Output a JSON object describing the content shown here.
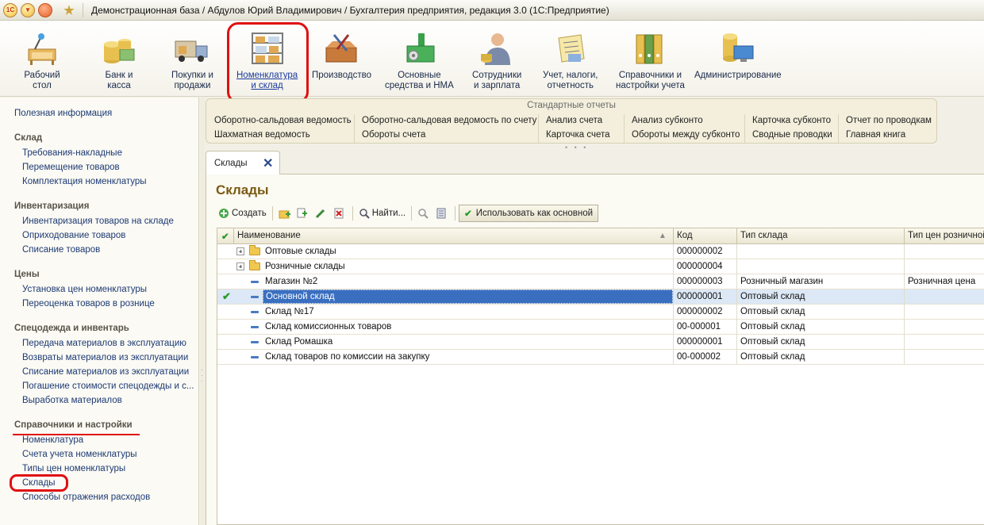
{
  "titlebar": {
    "logo": "1С",
    "title": "Демонстрационная база / Абдулов Юрий Владимирович / Бухгалтерия предприятия, редакция 3.0  (1С:Предприятие)"
  },
  "ribbon": [
    {
      "line1": "Рабочий",
      "line2": "стол",
      "icon": "desk-icon"
    },
    {
      "line1": "Банк и",
      "line2": "касса",
      "icon": "money-icon"
    },
    {
      "line1": "Покупки и",
      "line2": "продажи",
      "icon": "truck-icon"
    },
    {
      "line1": "Номенклатура",
      "line2": "и склад",
      "icon": "warehouse-shelves-icon",
      "active": true
    },
    {
      "line1": "Производство",
      "line2": "",
      "icon": "tools-box-icon"
    },
    {
      "line1": "Основные",
      "line2": "средства и НМА",
      "icon": "factory-icon"
    },
    {
      "line1": "Сотрудники",
      "line2": "и зарплата",
      "icon": "employee-icon"
    },
    {
      "line1": "Учет, налоги,",
      "line2": "отчетность",
      "icon": "reports-icon"
    },
    {
      "line1": "Справочники и",
      "line2": "настройки учета",
      "icon": "binders-icon"
    },
    {
      "line1": "Администрирование",
      "line2": "",
      "icon": "database-icon"
    }
  ],
  "left_panel": {
    "info": "Полезная информация",
    "groups": [
      {
        "title": "Склад",
        "items": [
          "Требования-накладные",
          "Перемещение товаров",
          "Комплектация номенклатуры"
        ]
      },
      {
        "title": "Инвентаризация",
        "items": [
          "Инвентаризация товаров на складе",
          "Оприходование товаров",
          "Списание товаров"
        ]
      },
      {
        "title": "Цены",
        "items": [
          "Установка цен номенклатуры",
          "Переоценка товаров в рознице"
        ]
      },
      {
        "title": "Спецодежда и инвентарь",
        "items": [
          "Передача материалов в эксплуатацию",
          "Возвраты материалов из эксплуатации",
          "Списание материалов из эксплуатации",
          "Погашение стоимости спецодежды и с...",
          "Выработка материалов"
        ]
      },
      {
        "title": "Справочники и настройки",
        "items": [
          "Номенклатура",
          "Счета учета номенклатуры",
          "Типы цен номенклатуры",
          "Склады",
          "Способы отражения расходов"
        ]
      }
    ]
  },
  "reports": {
    "title": "Стандартные отчеты",
    "col1": [
      "Оборотно-сальдовая ведомость",
      "Шахматная ведомость"
    ],
    "col2": [
      "Оборотно-сальдовая ведомость по счету",
      "Обороты счета"
    ],
    "col3": [
      "Анализ счета",
      "Карточка счета"
    ],
    "col4": [
      "Анализ субконто",
      "Обороты между субконто"
    ],
    "col5": [
      "Карточка субконто",
      "Сводные проводки"
    ],
    "col6": [
      "Отчет по проводкам",
      "Главная книга"
    ]
  },
  "tab": {
    "label": "Склады",
    "close": "✕"
  },
  "page": {
    "title": "Склады"
  },
  "toolbar": {
    "create": "Создать",
    "find": "Найти...",
    "use_as_main": "Использовать как основной"
  },
  "table": {
    "headers": {
      "name": "Наименование",
      "code": "Код",
      "type": "Тип склада",
      "price_type": "Тип цен розничной"
    },
    "rows": [
      {
        "kind": "group",
        "name": "Оптовые склады",
        "code": "000000002",
        "type": "",
        "price": ""
      },
      {
        "kind": "group",
        "name": "Розничные склады",
        "code": "000000004",
        "type": "",
        "price": ""
      },
      {
        "kind": "item",
        "name": "Магазин №2",
        "code": "000000003",
        "type": "Розничный магазин",
        "price": "Розничная цена"
      },
      {
        "kind": "item",
        "name": "Основной склад",
        "code": "000000001",
        "type": "Оптовый склад",
        "price": "",
        "selected": true,
        "main": true
      },
      {
        "kind": "item",
        "name": "Склад №17",
        "code": "000000002",
        "type": "Оптовый склад",
        "price": ""
      },
      {
        "kind": "item",
        "name": "Склад комиссионных товаров",
        "code": "00-000001",
        "type": "Оптовый склад",
        "price": ""
      },
      {
        "kind": "item",
        "name": "Склад Ромашка",
        "code": "000000001",
        "type": "Оптовый склад",
        "price": ""
      },
      {
        "kind": "item",
        "name": "Склад товаров по комиссии на закупку",
        "code": "00-000002",
        "type": "Оптовый склад",
        "price": ""
      }
    ]
  }
}
